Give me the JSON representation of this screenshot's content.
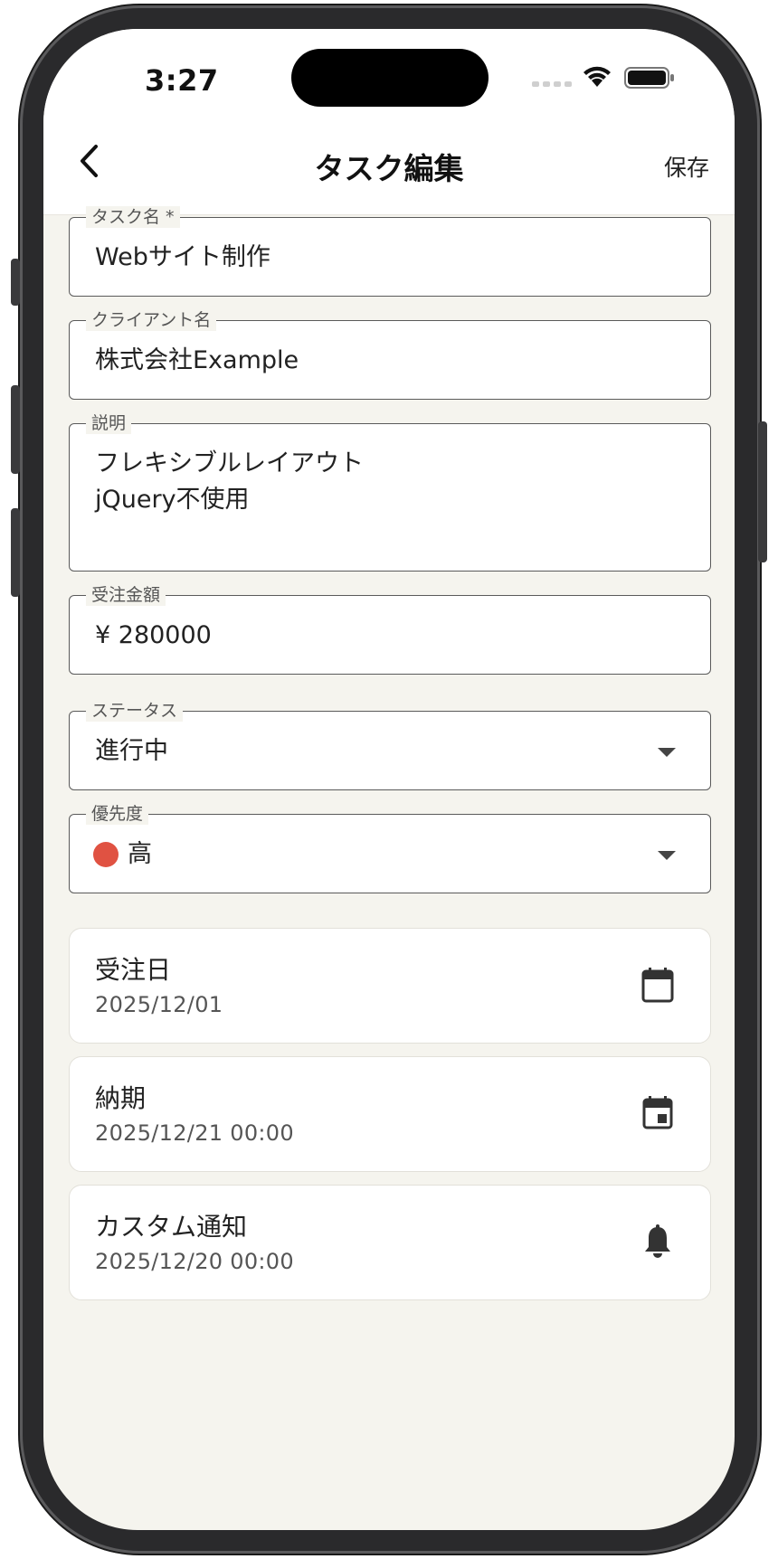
{
  "status_bar": {
    "time": "3:27"
  },
  "nav": {
    "title": "タスク編集",
    "save_label": "保存",
    "back_icon": "chevron-left-icon"
  },
  "form": {
    "task_name": {
      "label": "タスク名 *",
      "value": "Webサイト制作"
    },
    "client_name": {
      "label": "クライアント名",
      "value": "株式会社Example"
    },
    "description": {
      "label": "説明",
      "value": "フレキシブルレイアウト\njQuery不使用"
    },
    "amount": {
      "label": "受注金額",
      "value": "¥ 280000"
    },
    "status": {
      "label": "ステータス",
      "value": "進行中"
    },
    "priority": {
      "label": "優先度",
      "value": "高",
      "dot_color": "#e05242"
    }
  },
  "cards": {
    "order_date": {
      "title": "受注日",
      "value": "2025/12/01",
      "icon": "calendar-icon"
    },
    "due_date": {
      "title": "納期",
      "value": "2025/12/21 00:00",
      "icon": "calendar-event-icon"
    },
    "notification": {
      "title": "カスタム通知",
      "value": "2025/12/20 00:00",
      "icon": "bell-icon"
    }
  },
  "colors": {
    "background": "#f5f4ee",
    "border": "#5a5a5a",
    "priority_high": "#e05242"
  }
}
